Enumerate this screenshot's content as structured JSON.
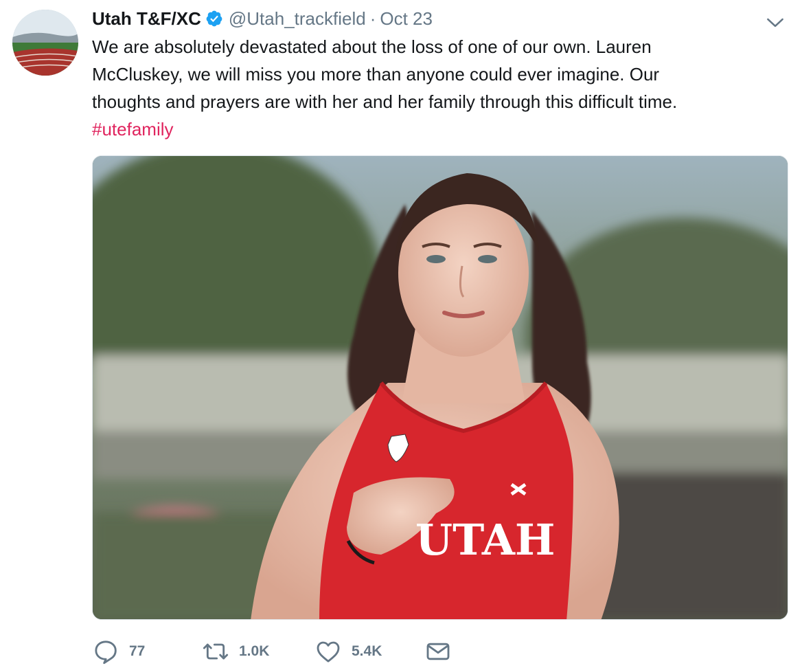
{
  "tweet": {
    "display_name": "Utah T&F/XC",
    "verified": true,
    "handle": "@Utah_trackfield",
    "separator": "·",
    "date": "Oct 23",
    "text_lines": [
      "We are absolutely devastated about the loss of one of our own. Lauren",
      "McCluskey, we will miss you more than anyone could ever imagine. Our",
      "thoughts and prayers are with her and her family through this difficult time."
    ],
    "hashtag": "#utefamily",
    "media": {
      "jersey_text": "UTAH",
      "jersey_color": "#d7262d"
    },
    "actions": {
      "reply_count": "77",
      "retweet_count": "1.0K",
      "like_count": "5.4K"
    }
  },
  "icons": {
    "verified": "verified-badge-icon",
    "caret": "chevron-down-icon",
    "reply": "reply-icon",
    "retweet": "retweet-icon",
    "like": "heart-icon",
    "dm": "envelope-icon"
  },
  "colors": {
    "text_primary": "#14171a",
    "text_secondary": "#657786",
    "hashtag": "#e0245e",
    "verified_blue": "#1da1f2"
  }
}
